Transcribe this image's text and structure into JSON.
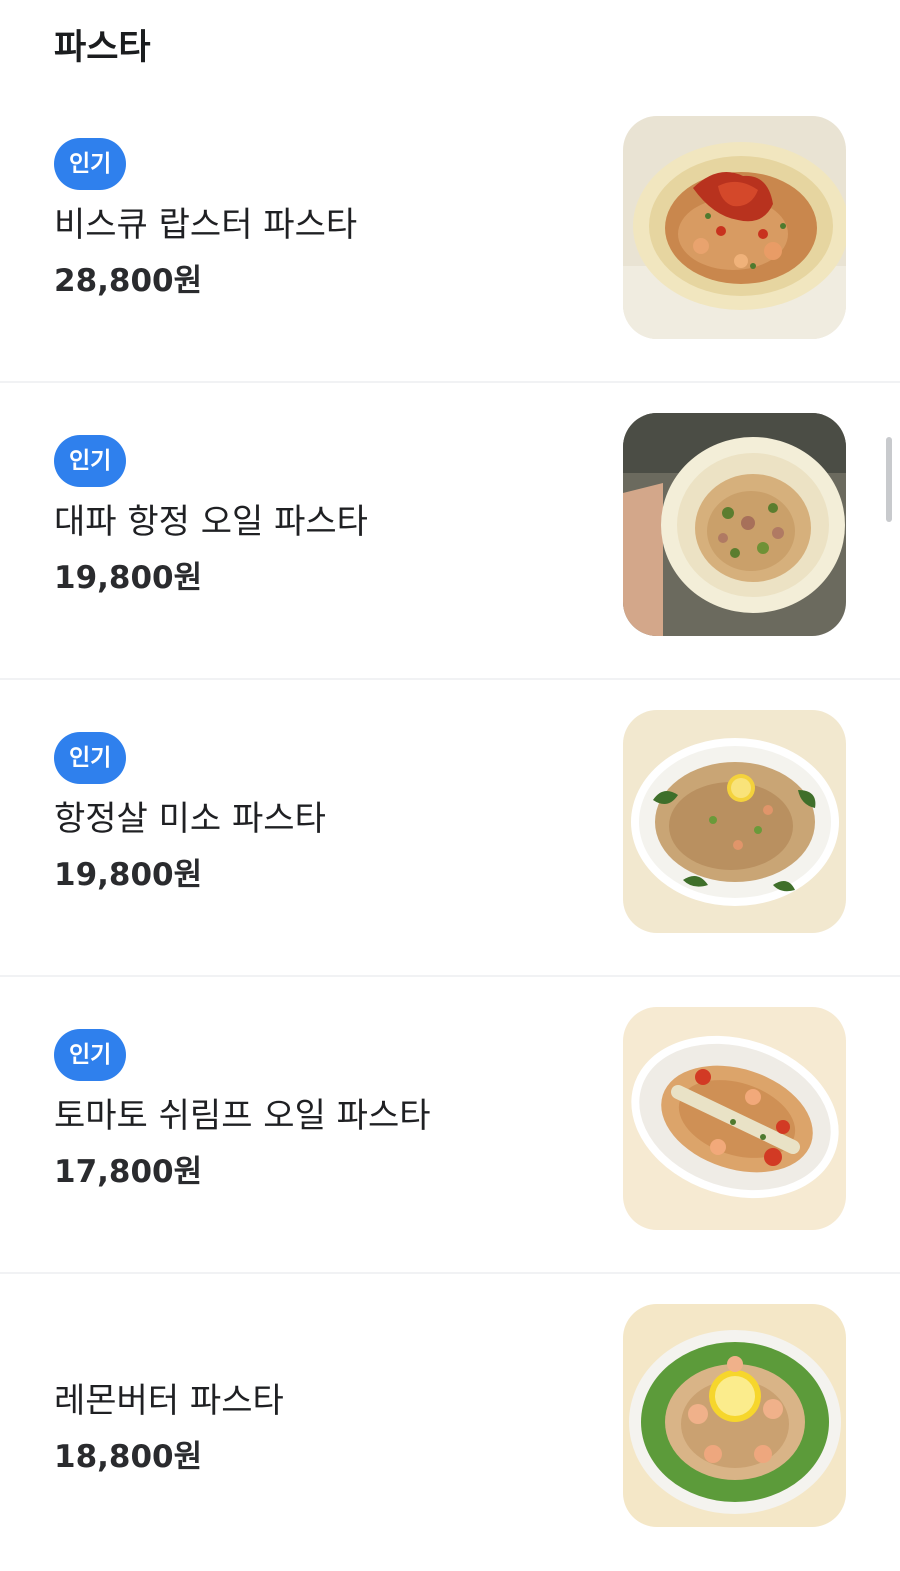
{
  "section": {
    "title": "파스타"
  },
  "badge_color": "#2f80ed",
  "items": [
    {
      "badge": "인기",
      "name": "비스큐 랍스터 파스타",
      "price": "28,800원",
      "image_icon": "lobster-pasta-photo"
    },
    {
      "badge": "인기",
      "name": "대파 항정 오일 파스타",
      "price": "19,800원",
      "image_icon": "pork-oil-pasta-photo"
    },
    {
      "badge": "인기",
      "name": "항정살 미소 파스타",
      "price": "19,800원",
      "image_icon": "miso-pasta-photo"
    },
    {
      "badge": "인기",
      "name": "토마토 쉬림프 오일 파스타",
      "price": "17,800원",
      "image_icon": "shrimp-pasta-photo"
    },
    {
      "name": "레몬버터 파스타",
      "price": "18,800원",
      "image_icon": "lemon-butter-pasta-photo"
    }
  ]
}
